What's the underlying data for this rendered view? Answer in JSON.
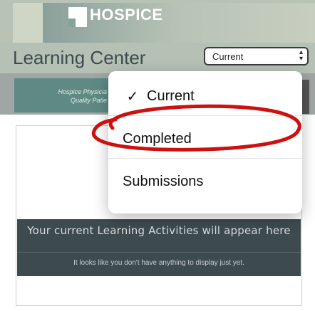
{
  "header": {
    "brand": "HOSPICE",
    "page_title": "Learning Center"
  },
  "status_select": {
    "value": "Current",
    "options": [
      "Current",
      "Completed",
      "Submissions"
    ]
  },
  "thumbnail": {
    "line1": "Hospice Physicia",
    "line2": "Quality Patie"
  },
  "dropdown": {
    "items": [
      {
        "label": "Current",
        "checked": true,
        "check_glyph": "✓"
      },
      {
        "label": "Completed",
        "checked": false
      },
      {
        "label": "Submissions",
        "checked": false
      }
    ]
  },
  "empty_state": {
    "heading": "Your current Learning Activities will appear here",
    "message": "It looks like you don't have anything to display just yet."
  },
  "colors": {
    "annotation": "#cc1111",
    "panel": "#3d4b4f",
    "header": "#b6c1b6"
  }
}
